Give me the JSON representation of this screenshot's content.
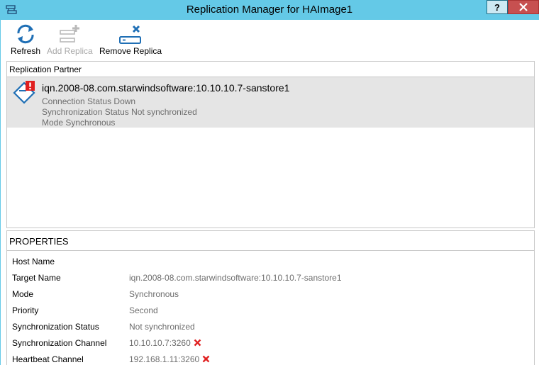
{
  "window": {
    "title": "Replication Manager for HAImage1",
    "help_label": "?",
    "close_label": "✕"
  },
  "toolbar": {
    "refresh_label": "Refresh",
    "add_replica_label": "Add Replica",
    "remove_replica_label": "Remove Replica"
  },
  "partners": {
    "header": "Replication Partner",
    "items": [
      {
        "name": "iqn.2008-08.com.starwindsoftware:10.10.10.7-sanstore1",
        "connection": "Connection Status Down",
        "sync": "Synchronization Status Not synchronized",
        "mode": "Mode Synchronous"
      }
    ]
  },
  "properties": {
    "title": "PROPERTIES",
    "rows": [
      {
        "label": "Host Name",
        "value": ""
      },
      {
        "label": "Target Name",
        "value": "iqn.2008-08.com.starwindsoftware:10.10.10.7-sanstore1"
      },
      {
        "label": "Mode",
        "value": "Synchronous"
      },
      {
        "label": "Priority",
        "value": "Second"
      },
      {
        "label": "Synchronization Status",
        "value": "Not synchronized"
      },
      {
        "label": "Synchronization Channel",
        "value": "10.10.10.7:3260"
      },
      {
        "label": "Heartbeat Channel",
        "value": "192.168.1.11:3260"
      }
    ]
  },
  "icons": {
    "app": "replication-app-icon",
    "refresh": "refresh-icon",
    "add": "add-replica-icon",
    "remove": "remove-replica-icon",
    "partner": "storage-device-icon",
    "error": "error-x-icon"
  },
  "colors": {
    "titlebar": "#64c9e7",
    "close": "#c75050",
    "accent": "#1f6fb5",
    "error": "#e01f1f",
    "selected_row": "#e5e5e5"
  }
}
